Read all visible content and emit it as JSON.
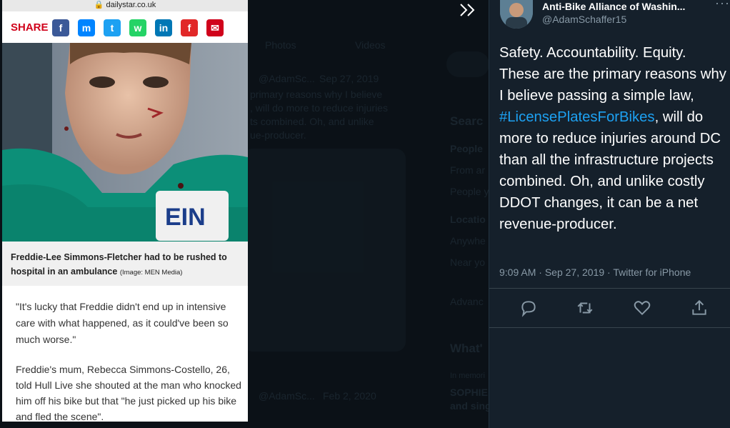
{
  "background": {
    "tabs": [
      "Photos",
      "Videos"
    ],
    "faded_tweet_1": {
      "handle": "@AdamSc...",
      "date": "Sep 27, 2019",
      "lines": [
        "primary reasons why I believe",
        ", will do more to reduce injuries",
        "ts combined. Oh, and unlike",
        "ue-producer."
      ]
    },
    "faded_tweet_2": {
      "handle": "@AdamSc...",
      "date": "Feb 2, 2020"
    },
    "sidebar": [
      "Searc",
      "People",
      "From ar",
      "People y",
      "Locatio",
      "Anywhe",
      "Near yo",
      "Advanc",
      "What'",
      "In memori",
      "SOPHIE",
      "and sing"
    ]
  },
  "article": {
    "url": "dailystar.co.uk",
    "share_label": "SHARE",
    "share_icons": [
      {
        "name": "facebook-icon",
        "glyph": "f",
        "color": "#3b5998"
      },
      {
        "name": "messenger-icon",
        "glyph": "m",
        "color": "#0084ff"
      },
      {
        "name": "twitter-icon",
        "glyph": "t",
        "color": "#1da1f2"
      },
      {
        "name": "whatsapp-icon",
        "glyph": "w",
        "color": "#25d366"
      },
      {
        "name": "linkedin-icon",
        "glyph": "in",
        "color": "#0077b5"
      },
      {
        "name": "flipboard-icon",
        "glyph": "f",
        "color": "#e12828"
      },
      {
        "name": "email-icon",
        "glyph": "✉",
        "color": "#d0021b"
      }
    ],
    "photo_alt": "Child in green school sweatshirt with facial injuries",
    "sweatshirt_logo": "EIN",
    "caption": "Freddie-Lee Simmons-Fletcher had to be rushed to hospital in an ambulance",
    "caption_credit": "(Image: MEN Media)",
    "quote": "\"It's lucky that Freddie didn't end up in intensive care with what happened, as it could've been so much worse.\"",
    "paragraph": "Freddie's mum, Rebecca Simmons-Costello, 26, told Hull Live she shouted at the man who knocked him off his bike but that \"he just picked up his bike and fled the scene\"."
  },
  "tweet": {
    "display_name": "Anti-Bike Alliance of Washin...",
    "handle": "@AdamSchaffer15",
    "body_before": "Safety. Accountability. Equity. These are the primary reasons why I believe passing a simple law, ",
    "hashtag": "#LicensePlatesForBikes",
    "body_after": ", will do more to reduce injuries around DC than all the infrastructure projects combined. Oh, and unlike costly DDOT changes, it can be a net revenue-producer.",
    "time": "9:09 AM",
    "date": "Sep 27, 2019",
    "source": "Twitter for iPhone",
    "meta_separator": "·",
    "more_glyph": "···",
    "actions": [
      "reply-icon",
      "retweet-icon",
      "like-icon",
      "share-icon"
    ]
  },
  "colors": {
    "twitter_bg": "#15202b",
    "twitter_blue": "#1da1f2",
    "muted": "#8899a6",
    "share_red": "#d0021b"
  }
}
